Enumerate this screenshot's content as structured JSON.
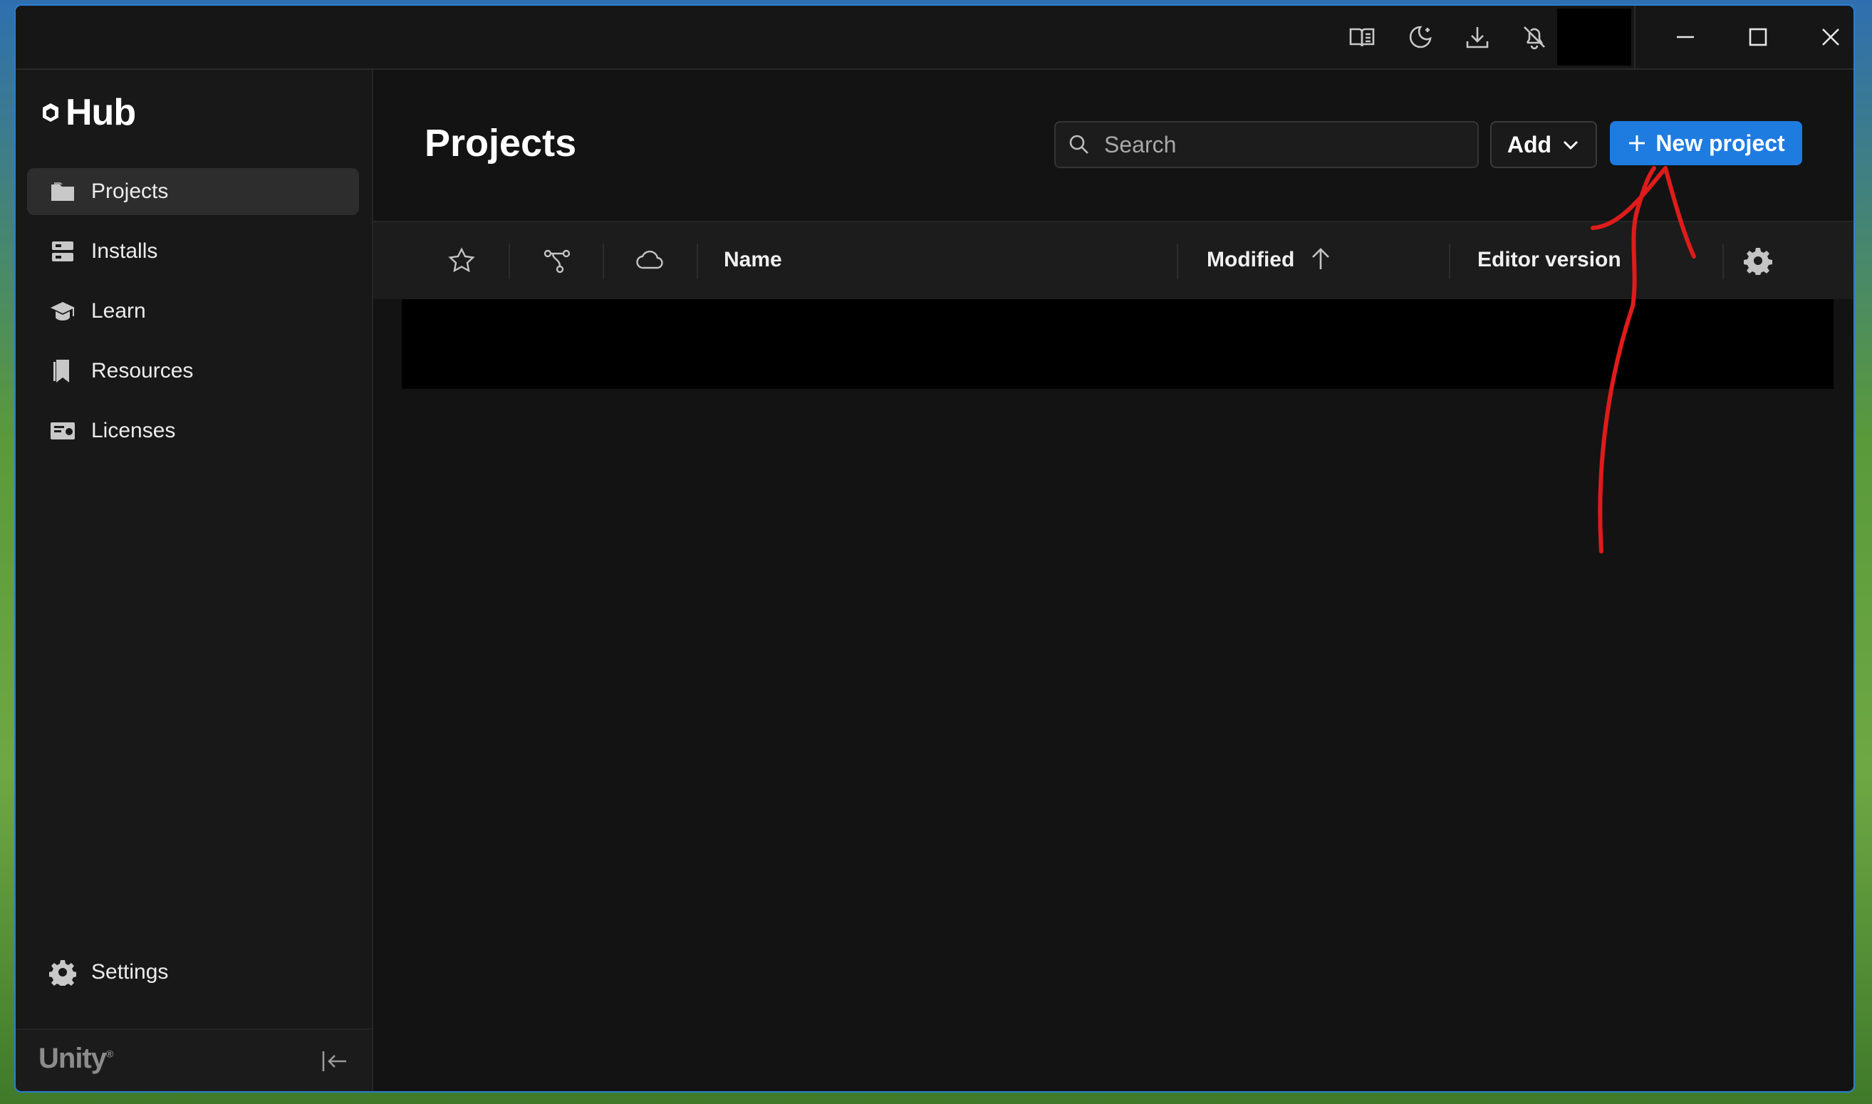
{
  "app": {
    "logo_text": "Hub",
    "brand_footer": "Unity",
    "brand_mark": "®"
  },
  "titlebar": {
    "icons": [
      "book-icon",
      "theme-moon-icon",
      "download-icon",
      "notifications-off-icon"
    ],
    "window_controls": [
      "minimize",
      "maximize",
      "close"
    ]
  },
  "sidebar": {
    "items": [
      {
        "label": "Projects",
        "icon": "folder-icon",
        "active": true
      },
      {
        "label": "Installs",
        "icon": "installs-icon"
      },
      {
        "label": "Learn",
        "icon": "graduation-cap-icon"
      },
      {
        "label": "Resources",
        "icon": "bookmark-icon"
      },
      {
        "label": "Licenses",
        "icon": "license-icon"
      }
    ],
    "settings_label": "Settings"
  },
  "main": {
    "title": "Projects",
    "search": {
      "placeholder": "Search",
      "value": ""
    },
    "add_label": "Add",
    "new_project_label": "New project",
    "columns": {
      "name": "Name",
      "modified": "Modified",
      "editor_version": "Editor version"
    }
  },
  "colors": {
    "accent": "#1e7be0",
    "background": "#131313",
    "annotation": "#e01b1b"
  }
}
